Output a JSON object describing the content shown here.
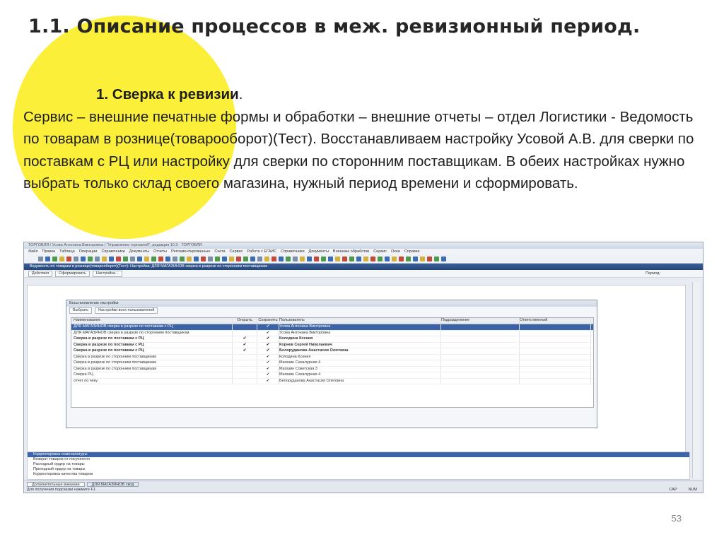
{
  "slide": {
    "title": "1.1. Описание процессов в меж. ревизионный период.",
    "step_heading": "1. Сверка к ревизии",
    "step_heading_suffix": ".",
    "paragraph": "Сервис – внешние печатные формы и обработки – внешние отчеты – отдел Логистики - Ведомость по товарам в рознице(товарооборот)(Тест). Восстанавливаем настройку Усовой А.В. для сверки по поставкам с РЦ или настройку для сверки по сторонним поставщикам. В обеих настройках нужно выбрать только склад своего магазина, нужный период времени и сформировать.",
    "page_number": "53",
    "accent_color": "#fbef3a"
  },
  "screenshot": {
    "window_title": "ТОРГОВЛЯ / Усова Антонина Викторовна / \"Управление торговлей\", редакция 10.3 - ТОРГОВЛЯ",
    "menu": [
      "Файл",
      "Правка",
      "Таблица",
      "Операции",
      "Справочники",
      "Документы",
      "Отчеты",
      "Регламентированные",
      "Счета",
      "Сервис",
      "Работа с ЕГАИС",
      "Справочники",
      "Документы",
      "Внешние обработки",
      "Сервис",
      "Окна",
      "Справка"
    ],
    "document_title": "Ведомость по товарам в рознице(товарооборот)(Тест): Настройка: ДЛЯ МАГАЗИНОВ сверка в разрезе по сторонним поставщикам",
    "commands": [
      "Действия",
      "Сформировать",
      "Настройка..."
    ],
    "dialog": {
      "title": "Восстановление настройки",
      "buttons": [
        "Выбрать",
        "Настройки всех пользователей"
      ],
      "columns": [
        "Наименование",
        "Открыть",
        "Сохранять",
        "Пользователь",
        "Подразделение",
        "Ответственный"
      ],
      "rows": [
        {
          "name": "ДЛЯ МАГАЗИНОВ сверка в разрезе по поставкам с РЦ",
          "open": "",
          "save": "✔",
          "user": "Усова Антонина Викторовна",
          "selected": true,
          "bold": false
        },
        {
          "name": "ДЛЯ МАГАЗИНОВ сверка в разрезе по сторонним поставщикам",
          "open": "",
          "save": "✔",
          "user": "Усова Антонина Викторовна",
          "selected": false,
          "bold": false
        },
        {
          "name": "Сверка в разрезе по поставкам с РЦ",
          "open": "✔",
          "save": "✔",
          "user": "Колодина Ксения",
          "selected": false,
          "bold": true
        },
        {
          "name": "Сверка в разрезе по поставкам с РЦ",
          "open": "✔",
          "save": "✔",
          "user": "Корнев Сергей Николаевич",
          "selected": false,
          "bold": true
        },
        {
          "name": "Сверка в разрезе по поставкам с РЦ",
          "open": "✔",
          "save": "✔",
          "user": "Белоруданова Анастасия Олеговна",
          "selected": false,
          "bold": true
        },
        {
          "name": "Сверка в разрезе по сторонним поставщикам",
          "open": "",
          "save": "✔",
          "user": "Колодина Ксения",
          "selected": false,
          "bold": false
        },
        {
          "name": "Сверка в разрезе по сторонним поставщикам",
          "open": "",
          "save": "✔",
          "user": "Магазин Сахалурная 4",
          "selected": false,
          "bold": false
        },
        {
          "name": "Сверка в разрезе по сторонним поставщикам",
          "open": "",
          "save": "✔",
          "user": "Магазин Советская 3",
          "selected": false,
          "bold": false
        },
        {
          "name": "Сверка РЦ",
          "open": "",
          "save": "✔",
          "user": "Магазин Сахалурная 4",
          "selected": false,
          "bold": false
        },
        {
          "name": "отчет по чеку",
          "open": "",
          "save": "✔",
          "user": "Белоруданова Анастасия Олеговна",
          "selected": false,
          "bold": false
        }
      ]
    },
    "bottom_list": [
      "Корректировка номенклатуры",
      "Возврат товаров от покупателя",
      "Расходный ордер на товары",
      "Приходный ордер на товары",
      "Корректировка качества товаров"
    ],
    "tabs": [
      "Дополнительные внешние",
      "ДЛЯ МАГАЗИНОВ свод"
    ],
    "status_text": "Для получения подсказки нажмите F1",
    "status_right": [
      "CAP",
      "NUM"
    ],
    "period_label": "Период:"
  }
}
